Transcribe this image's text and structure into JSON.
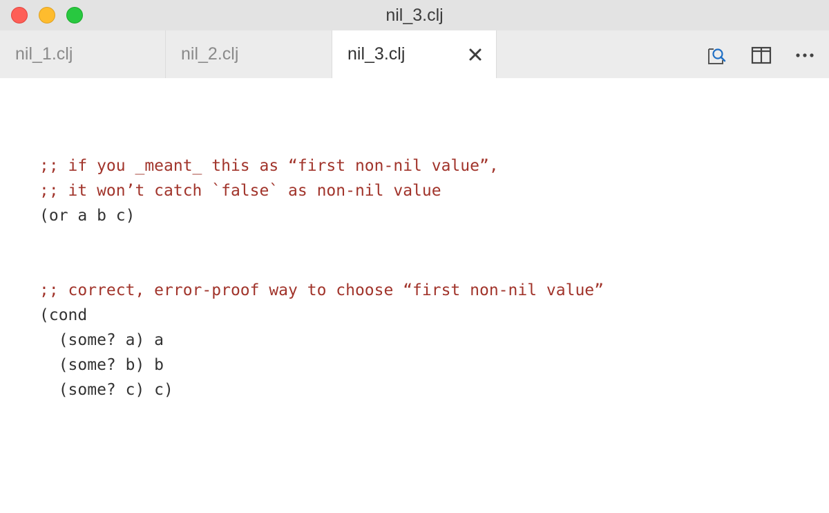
{
  "window": {
    "title": "nil_3.clj"
  },
  "tabs": [
    {
      "label": "nil_1.clj",
      "active": false
    },
    {
      "label": "nil_2.clj",
      "active": false
    },
    {
      "label": "nil_3.clj",
      "active": true
    }
  ],
  "icons": {
    "tab_close": "close-icon",
    "find": "find-in-file-icon",
    "split": "split-editor-icon",
    "more": "more-actions-icon"
  },
  "colors": {
    "comment": "#a1342b",
    "code": "#333333",
    "titlebar": "#e3e3e3",
    "tabbar": "#ececec",
    "find_icon_accent": "#1f6fc5"
  },
  "editor": {
    "lines": [
      {
        "text": "",
        "kind": "plain"
      },
      {
        "text": ";; if you _meant_ this as “first non-nil value”,",
        "kind": "comment"
      },
      {
        "text": ";; it won’t catch `false` as non-nil value",
        "kind": "comment"
      },
      {
        "text": "(or a b c)",
        "kind": "plain"
      },
      {
        "text": "",
        "kind": "plain"
      },
      {
        "text": "",
        "kind": "plain"
      },
      {
        "text": ";; correct, error-proof way to choose “first non-nil value”",
        "kind": "comment"
      },
      {
        "text": "(cond",
        "kind": "plain"
      },
      {
        "text": "  (some? a) a",
        "kind": "plain"
      },
      {
        "text": "  (some? b) b",
        "kind": "plain"
      },
      {
        "text": "  (some? c) c)",
        "kind": "plain"
      }
    ]
  }
}
